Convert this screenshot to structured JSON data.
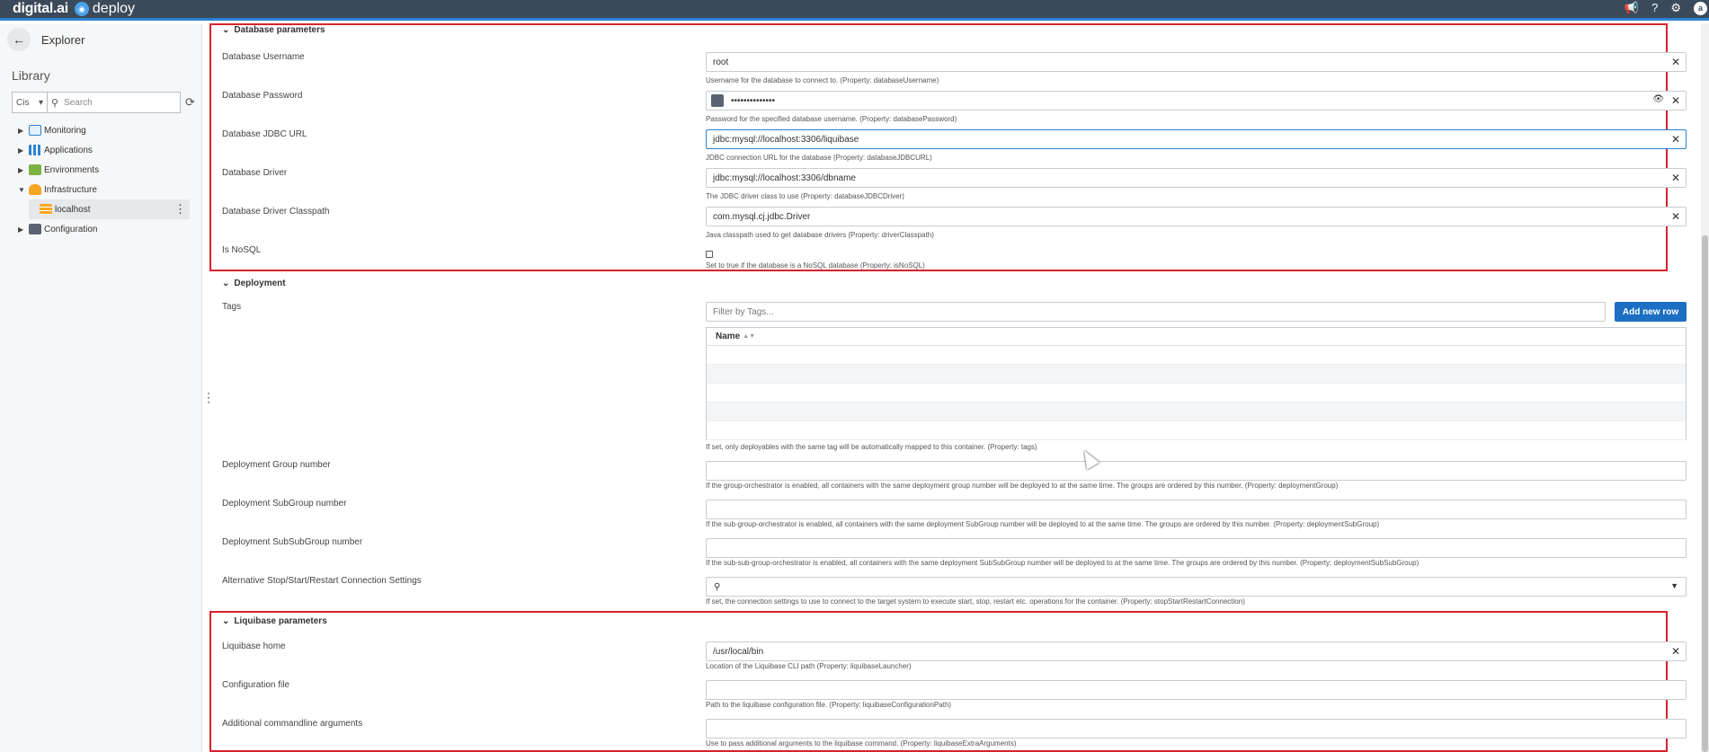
{
  "app": {
    "brand": "digital.ai",
    "product": "deploy"
  },
  "header": {
    "icons": [
      "megaphone-icon",
      "help-icon",
      "settings-icon",
      "user-avatar"
    ],
    "avatar_initial": "a"
  },
  "sidebar": {
    "title": "Explorer",
    "library_label": "Library",
    "type_select": "Cis",
    "search_placeholder": "Search",
    "tree": [
      {
        "label": "Monitoring",
        "icon": "monitor-icon",
        "expanded": false
      },
      {
        "label": "Applications",
        "icon": "applications-icon",
        "expanded": false
      },
      {
        "label": "Environments",
        "icon": "environments-icon",
        "expanded": false
      },
      {
        "label": "Infrastructure",
        "icon": "infrastructure-icon",
        "expanded": true
      },
      {
        "label": "localhost",
        "icon": "host-icon",
        "selected": true
      },
      {
        "label": "Configuration",
        "icon": "configuration-icon",
        "expanded": false
      }
    ]
  },
  "database": {
    "section_title": "Database parameters",
    "username": {
      "label": "Database Username",
      "value": "root",
      "hint": "Username for the database to connect to. (Property: databaseUsername)"
    },
    "password": {
      "label": "Database Password",
      "value": "••••••••••••••",
      "hint": "Password for the specified database username. (Property: databasePassword)"
    },
    "jdbc_url": {
      "label": "Database JDBC URL",
      "value": "jdbc:mysql://localhost:3306/liquibase",
      "hint": "JDBC connection URL for the database (Property: databaseJDBCURL)"
    },
    "driver": {
      "label": "Database Driver",
      "value": "jdbc:mysql://localhost:3306/dbname",
      "hint": "The JDBC driver class to use (Property: databaseJDBCDriver)"
    },
    "classpath": {
      "label": "Database Driver Classpath",
      "value": "com.mysql.cj.jdbc.Driver",
      "hint": "Java classpath used to get database drivers (Property: driverClasspath)"
    },
    "nosql": {
      "label": "Is NoSQL",
      "checked": false,
      "hint": "Set to true if the database is a NoSQL database (Property: isNoSQL)"
    }
  },
  "deployment": {
    "section_title": "Deployment",
    "tags": {
      "label": "Tags",
      "placeholder": "Filter by Tags...",
      "add_button": "Add new row",
      "column_name": "Name",
      "hint": "If set, only deployables with the same tag will be automatically mapped to this container. (Property: tags)"
    },
    "group": {
      "label": "Deployment Group number",
      "value": "",
      "hint": "If the group-orchestrator is enabled, all containers with the same deployment group number will be deployed to at the same time. The groups are ordered by this number. (Property: deploymentGroup)"
    },
    "subgroup": {
      "label": "Deployment SubGroup number",
      "value": "",
      "hint": "If the sub-group-orchestrator is enabled, all containers with the same deployment SubGroup number will be deployed to at the same time. The groups are ordered by this number. (Property: deploymentSubGroup)"
    },
    "subsubgroup": {
      "label": "Deployment SubSubGroup number",
      "value": "",
      "hint": "If the sub-sub-group-orchestrator is enabled, all containers with the same deployment SubSubGroup number will be deployed to at the same time. The groups are ordered by this number. (Property: deploymentSubSubGroup)"
    },
    "alt_conn": {
      "label": "Alternative Stop/Start/Restart Connection Settings",
      "hint": "If set, the connection settings to use to connect to the target system to execute start, stop, restart etc. operations for the container. (Property: stopStartRestartConnection)"
    }
  },
  "liquibase": {
    "section_title": "Liquibase parameters",
    "home": {
      "label": "Liquibase home",
      "value": "/usr/local/bin",
      "hint": "Location of the Liquibase CLI path (Property: liquibaseLauncher)"
    },
    "config": {
      "label": "Configuration file",
      "value": "",
      "hint": "Path to the liquibase configuration file. (Property: liquibaseConfigurationPath)"
    },
    "args": {
      "label": "Additional commandline arguments",
      "value": "",
      "hint": "Use to pass additional arguments to the liquibase command. (Property: liquibaseExtraArguments)"
    }
  },
  "colors": {
    "header_bg": "#3b4a5a",
    "accent": "#2c82d2",
    "highlight": "#d9212c",
    "primary_button": "#1c6fc2"
  }
}
